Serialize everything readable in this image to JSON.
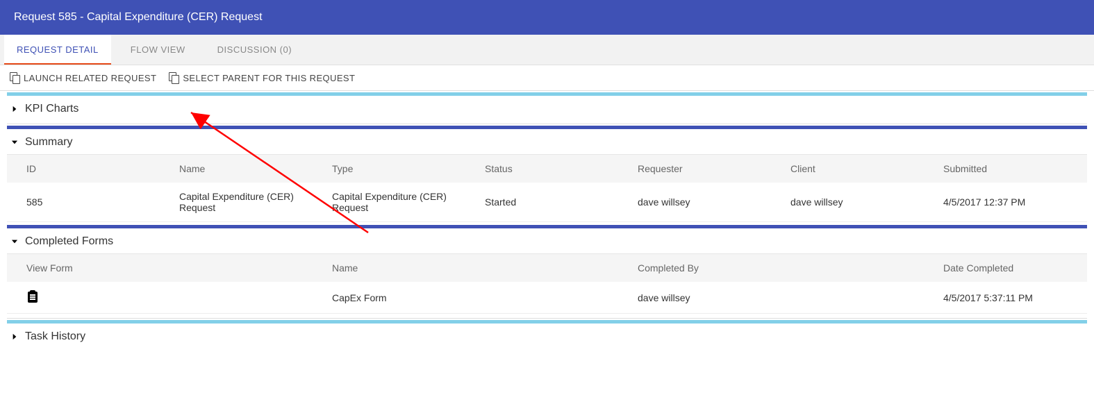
{
  "header": {
    "title": "Request 585 - Capital Expenditure (CER) Request"
  },
  "tabs": {
    "detail": "REQUEST DETAIL",
    "flow": "FLOW VIEW",
    "discussion": "DISCUSSION (0)"
  },
  "actions": {
    "launch_related": "LAUNCH RELATED REQUEST",
    "select_parent": "SELECT PARENT FOR THIS REQUEST"
  },
  "sections": {
    "kpi": "KPI Charts",
    "summary": "Summary",
    "completed_forms": "Completed Forms",
    "task_history": "Task History"
  },
  "summary": {
    "columns": {
      "id": "ID",
      "name": "Name",
      "type": "Type",
      "status": "Status",
      "requester": "Requester",
      "client": "Client",
      "submitted": "Submitted"
    },
    "row": {
      "id": "585",
      "name": "Capital Expenditure (CER) Request",
      "type": "Capital Expenditure (CER) Request",
      "status": "Started",
      "requester": "dave willsey",
      "client": "dave willsey",
      "submitted": "4/5/2017 12:37 PM"
    }
  },
  "completed_forms": {
    "columns": {
      "view_form": "View Form",
      "name": "Name",
      "completed_by": "Completed By",
      "date_completed": "Date Completed"
    },
    "row": {
      "name": "CapEx Form",
      "completed_by": "dave willsey",
      "date_completed": "4/5/2017 5:37:11 PM"
    }
  }
}
